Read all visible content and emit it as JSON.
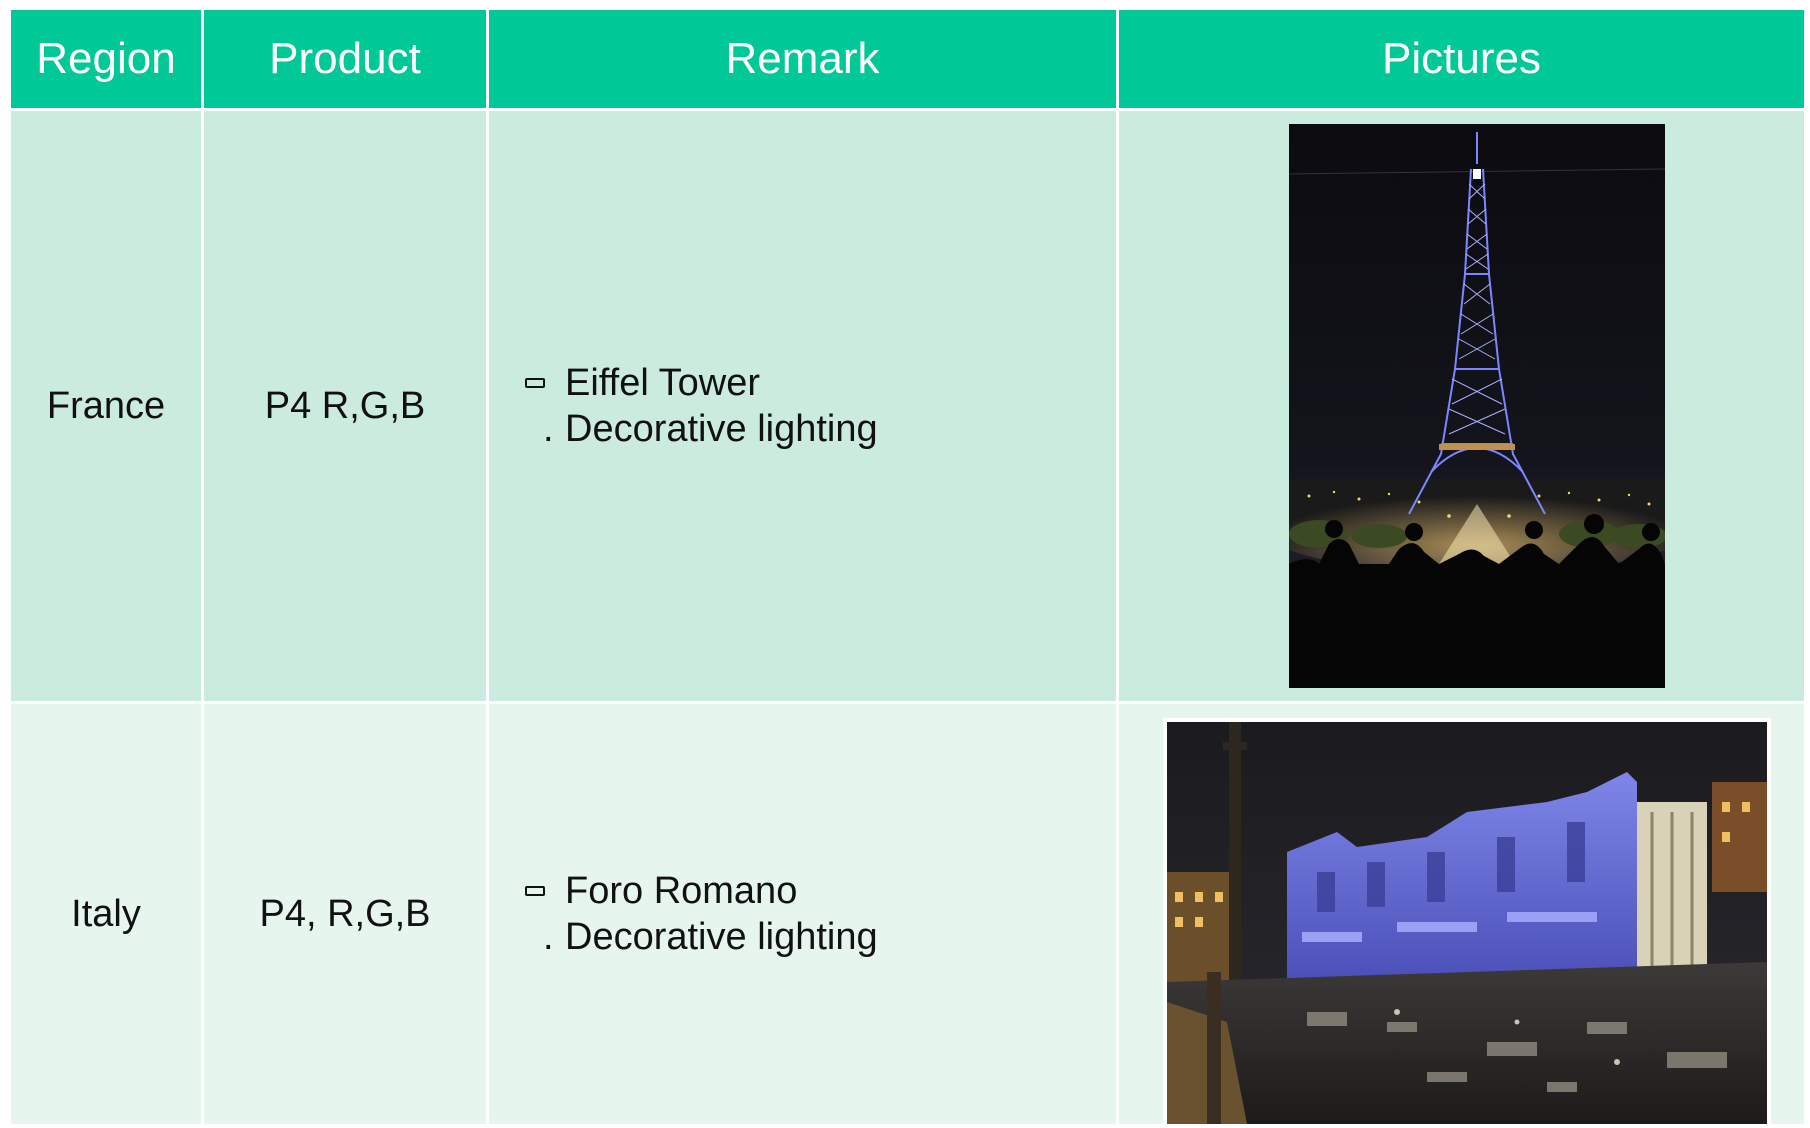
{
  "table": {
    "headers": [
      "Region",
      "Product",
      "Remark",
      "Pictures"
    ],
    "rows": [
      {
        "region": "France",
        "product": "P4 R,G,B",
        "remark_title": "Eiffel Tower",
        "remark_detail": "Decorative lighting",
        "bullet_glyph": "▭",
        "sub_glyph": ".",
        "picture_icon": "eiffel-tower-night-photo"
      },
      {
        "region": "Italy",
        "product": "P4, R,G,B",
        "remark_title": "Foro Romano",
        "remark_detail": "Decorative lighting",
        "bullet_glyph": "▭",
        "sub_glyph": ".",
        "picture_icon": "foro-romano-night-photo"
      }
    ]
  },
  "colors": {
    "header_bg": "#00c896",
    "row1_bg": "#ccebdf",
    "row2_bg": "#e6f5ee",
    "lighting_blue": "#5a6ee0"
  }
}
